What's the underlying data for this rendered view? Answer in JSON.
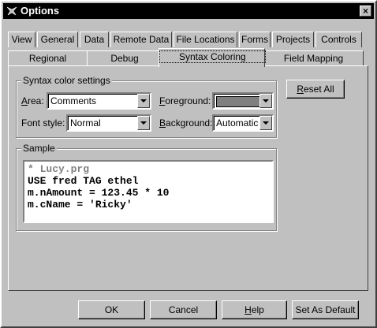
{
  "window": {
    "title": "Options",
    "close_symbol": "×"
  },
  "tabs_row1": [
    "View",
    "General",
    "Data",
    "Remote Data",
    "File Locations",
    "Forms",
    "Projects",
    "Controls"
  ],
  "tabs_row2": [
    "Regional",
    "Debug",
    "Syntax Coloring",
    "Field Mapping"
  ],
  "active_tab": "Syntax Coloring",
  "settings": {
    "group_label": "Syntax color settings",
    "area": {
      "label_u": "A",
      "label_rest": "rea:",
      "value": "Comments"
    },
    "font_style": {
      "label": "Font style:",
      "value": "Normal"
    },
    "foreground": {
      "label_u": "F",
      "label_rest": "oreground:",
      "color": "#808080"
    },
    "background": {
      "label_u": "B",
      "label_rest": "ackground:",
      "value": "Automatic"
    }
  },
  "reset_all": {
    "label_u": "R",
    "label_rest": "eset All"
  },
  "sample": {
    "label": "Sample",
    "lines": [
      "* Lucy.prg",
      "USE fred TAG ethel",
      "m.nAmount = 123.45 * 10",
      "m.cName = 'Ricky'"
    ],
    "comment_color": "#808080"
  },
  "buttons": {
    "ok": "OK",
    "cancel": "Cancel",
    "help_u": "H",
    "help_rest": "elp",
    "set_default": "Set As Default"
  }
}
